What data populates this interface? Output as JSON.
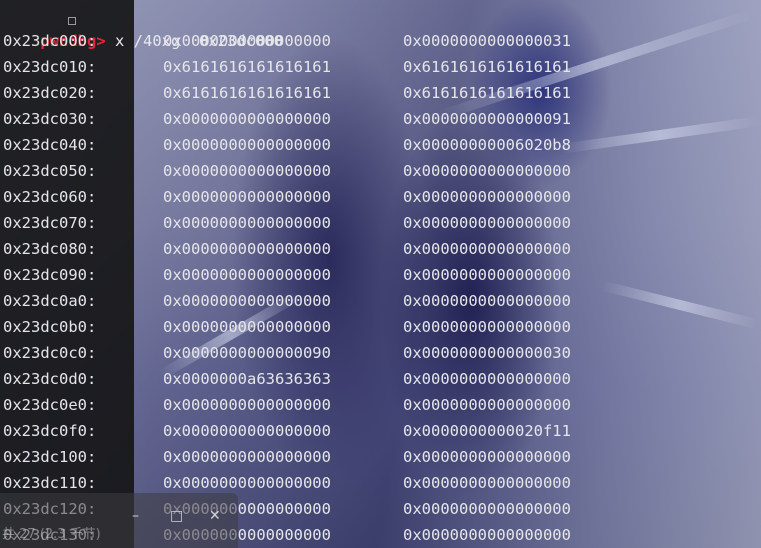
{
  "prompt": {
    "label": "pwndbg>",
    "command": " x /40xg  0x23dc000"
  },
  "memory_rows": [
    {
      "addr": "0x23dc000:",
      "v1": "0x0000000000000000",
      "v2": "0x0000000000000031"
    },
    {
      "addr": "0x23dc010:",
      "v1": "0x6161616161616161",
      "v2": "0x6161616161616161"
    },
    {
      "addr": "0x23dc020:",
      "v1": "0x6161616161616161",
      "v2": "0x6161616161616161"
    },
    {
      "addr": "0x23dc030:",
      "v1": "0x0000000000000000",
      "v2": "0x0000000000000091"
    },
    {
      "addr": "0x23dc040:",
      "v1": "0x0000000000000000",
      "v2": "0x00000000006020b8"
    },
    {
      "addr": "0x23dc050:",
      "v1": "0x0000000000000000",
      "v2": "0x0000000000000000"
    },
    {
      "addr": "0x23dc060:",
      "v1": "0x0000000000000000",
      "v2": "0x0000000000000000"
    },
    {
      "addr": "0x23dc070:",
      "v1": "0x0000000000000000",
      "v2": "0x0000000000000000"
    },
    {
      "addr": "0x23dc080:",
      "v1": "0x0000000000000000",
      "v2": "0x0000000000000000"
    },
    {
      "addr": "0x23dc090:",
      "v1": "0x0000000000000000",
      "v2": "0x0000000000000000"
    },
    {
      "addr": "0x23dc0a0:",
      "v1": "0x0000000000000000",
      "v2": "0x0000000000000000"
    },
    {
      "addr": "0x23dc0b0:",
      "v1": "0x0000000000000000",
      "v2": "0x0000000000000000"
    },
    {
      "addr": "0x23dc0c0:",
      "v1": "0x0000000000000090",
      "v2": "0x0000000000000030"
    },
    {
      "addr": "0x23dc0d0:",
      "v1": "0x0000000a63636363",
      "v2": "0x0000000000000000"
    },
    {
      "addr": "0x23dc0e0:",
      "v1": "0x0000000000000000",
      "v2": "0x0000000000000000"
    },
    {
      "addr": "0x23dc0f0:",
      "v1": "0x0000000000000000",
      "v2": "0x0000000000020f11"
    },
    {
      "addr": "0x23dc100:",
      "v1": "0x0000000000000000",
      "v2": "0x0000000000000000"
    },
    {
      "addr": "0x23dc110:",
      "v1": "0x0000000000000000",
      "v2": "0x0000000000000000"
    },
    {
      "addr": "0x23dc120:",
      "v1": "0x0000000000000000",
      "v2": "0x0000000000000000"
    },
    {
      "addr": "0x23dc130:",
      "v1": "0x0000000000000000",
      "v2": "0x0000000000000000"
    }
  ],
  "taskbar": {
    "minimize": "–",
    "maximize": "□",
    "close": "✕",
    "caption": "共 27 (2.3 千节)"
  },
  "colors": {
    "prompt": "#e0293b",
    "text": "#e6e6ea",
    "panel": "#161618"
  }
}
